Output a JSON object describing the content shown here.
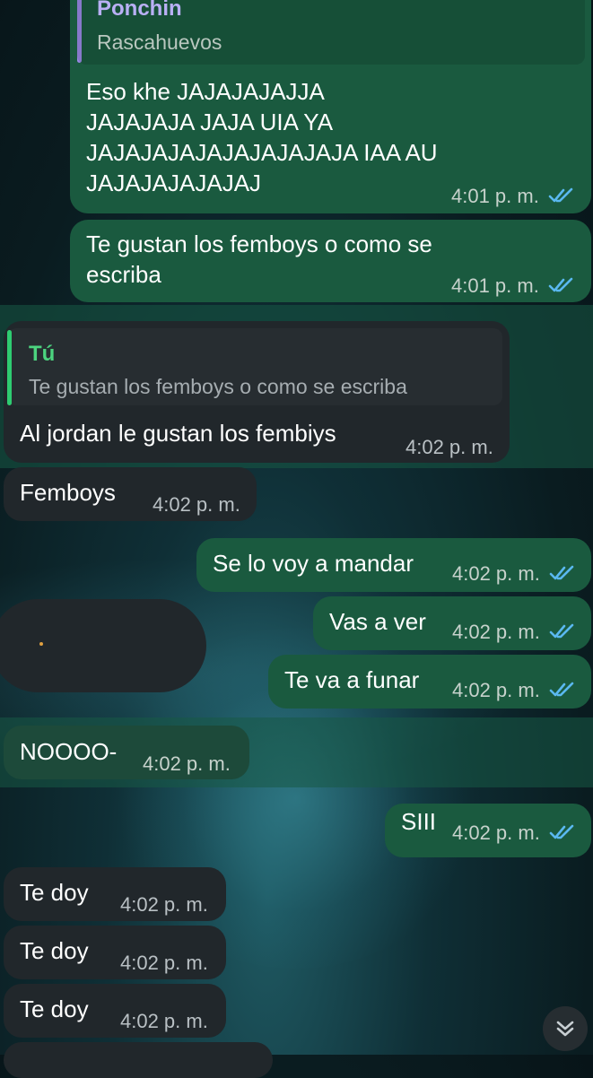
{
  "messages": {
    "m1": {
      "reply_name": "Ponchin",
      "reply_text": "Rascahuevos",
      "lines": [
        "Eso khe JAJAJAJAJJA",
        "JAJAJAJA JAJA UIA YA",
        "JAJAJAJAJAJAJAJAJAJA IAA AU",
        "JAJAJAJAJAJAJ"
      ],
      "time": "4:01 p. m."
    },
    "m2": {
      "lines": [
        "Te gustan los femboys o como se",
        "escriba"
      ],
      "time": "4:01 p. m."
    },
    "m3": {
      "reply_name": "Tú",
      "reply_text": "Te gustan los femboys o como se escriba",
      "text": "Al jordan le gustan los fembiys",
      "time": "4:02 p. m."
    },
    "m4": {
      "text": "Femboys",
      "time": "4:02 p. m."
    },
    "m5": {
      "text": "Se lo voy a mandar",
      "time": "4:02 p. m."
    },
    "m6": {
      "text": "Vas a ver",
      "time": "4:02 p. m."
    },
    "m7": {
      "text": "Te va a funar",
      "time": "4:02 p. m."
    },
    "m8": {
      "text": "NOOOO-",
      "time": "4:02 p. m."
    },
    "m9": {
      "text": "SIII",
      "time": "4:02 p. m."
    },
    "m10": {
      "text": "Te doy",
      "time": "4:02 p. m."
    },
    "m11": {
      "text": "Te doy",
      "time": "4:02 p. m."
    },
    "m12": {
      "text": "Te doy",
      "time": "4:02 p. m."
    }
  },
  "colors": {
    "outgoing_bubble": "#1a5a3f",
    "incoming_bubble": "#21272b",
    "read_check": "#5ab8f0",
    "reply_bar_ponchin": "#9a8ae6",
    "reply_bar_you": "#2ecc71"
  },
  "icons": {
    "read": "double-check-icon",
    "scroll": "chevron-double-down-icon"
  }
}
